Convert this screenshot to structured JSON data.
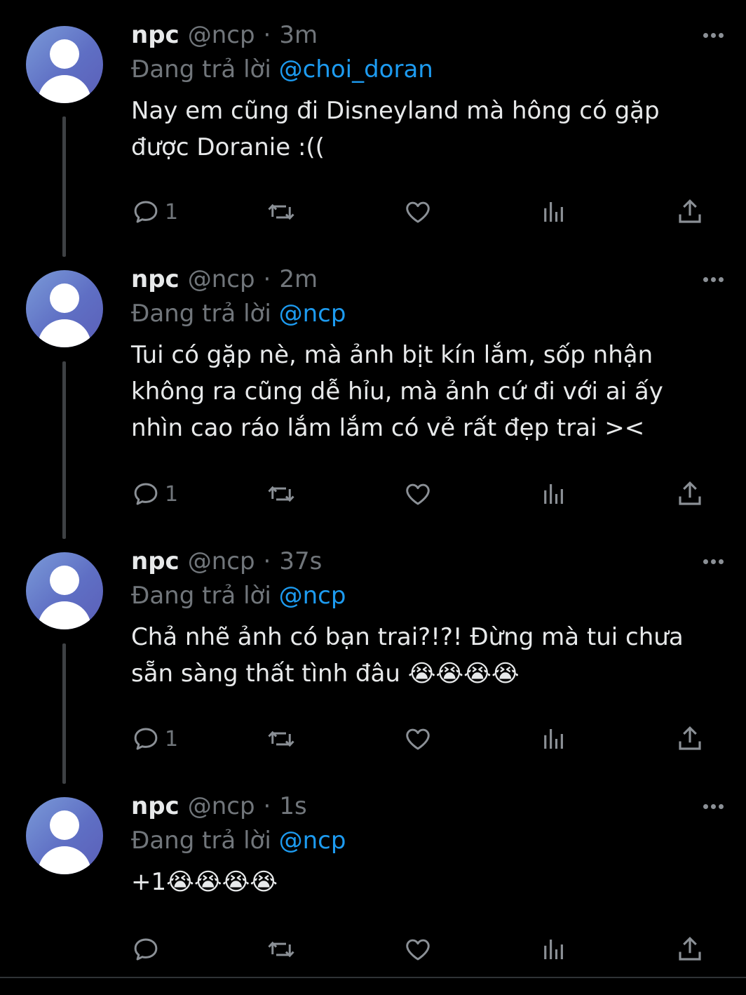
{
  "tweets": [
    {
      "name": "npc",
      "handle": "@ncp",
      "dot": "·",
      "time": "3m",
      "reply_prefix": "Đang trả lời",
      "reply_to": "@choi_doran",
      "text": "Nay em cũng đi Disneyland mà hông có gặp được Doranie :((",
      "reply_count": "1"
    },
    {
      "name": "npc",
      "handle": "@ncp",
      "dot": "·",
      "time": "2m",
      "reply_prefix": "Đang trả lời",
      "reply_to": "@ncp",
      "text": "Tui có gặp nè, mà ảnh bịt kín lắm, sốp nhận không ra cũng dễ hỉu, mà ảnh cứ đi với ai ấy nhìn cao ráo lắm lắm có vẻ rất đẹp trai ><",
      "reply_count": "1"
    },
    {
      "name": "npc",
      "handle": "@ncp",
      "dot": "·",
      "time": "37s",
      "reply_prefix": "Đang trả lời",
      "reply_to": "@ncp",
      "text": "Chả nhẽ ảnh có bạn trai?!?! Đừng mà tui chưa sẵn sàng thất tình đâu 😭😭😭😭",
      "reply_count": "1"
    },
    {
      "name": "npc",
      "handle": "@ncp",
      "dot": "·",
      "time": "1s",
      "reply_prefix": "Đang trả lời",
      "reply_to": "@ncp",
      "text": "+1😭😭😭😭",
      "reply_count": ""
    }
  ],
  "icons": {
    "reply": "reply-icon",
    "retweet": "retweet-icon",
    "like": "heart-icon",
    "views": "views-icon",
    "share": "share-icon",
    "more": "more-icon"
  },
  "colors": {
    "background": "#000000",
    "text": "#e7e9ea",
    "muted": "#71767b",
    "mention": "#1d9bf0"
  }
}
